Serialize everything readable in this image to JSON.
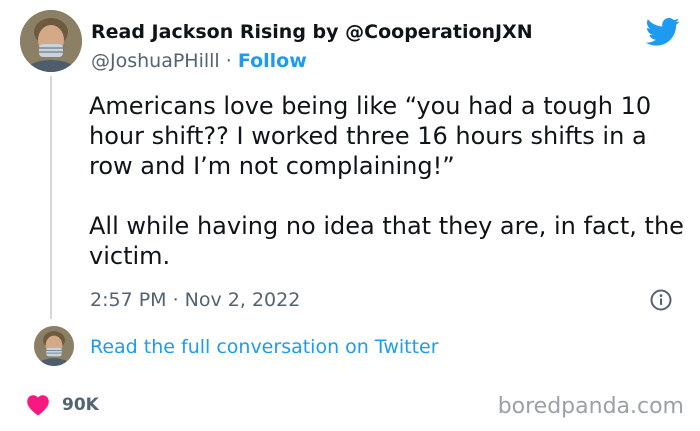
{
  "author": {
    "display_name": "Read Jackson Rising by @CooperationJXN",
    "handle": "@JoshuaPHilll",
    "separator": "·",
    "follow_label": "Follow"
  },
  "tweet": {
    "paragraphs": [
      "Americans love being like “you had a tough 10 hour shift?? I worked three 16 hours shifts in a row and I’m not complaining!”",
      "All while having no idea that they are, in fact, the victim."
    ],
    "timestamp": "2:57 PM · Nov 2, 2022"
  },
  "conversation_link": "Read the full conversation on Twitter",
  "likes": {
    "count": "90K"
  },
  "watermark": "boredpanda.com",
  "icons": {
    "brand": "twitter-bird-icon",
    "info": "info-icon",
    "like": "heart-icon"
  },
  "colors": {
    "twitter_blue": "#1d9bf0",
    "heart_red": "#f91880",
    "text_primary": "#0f1419",
    "text_secondary": "#536471"
  }
}
